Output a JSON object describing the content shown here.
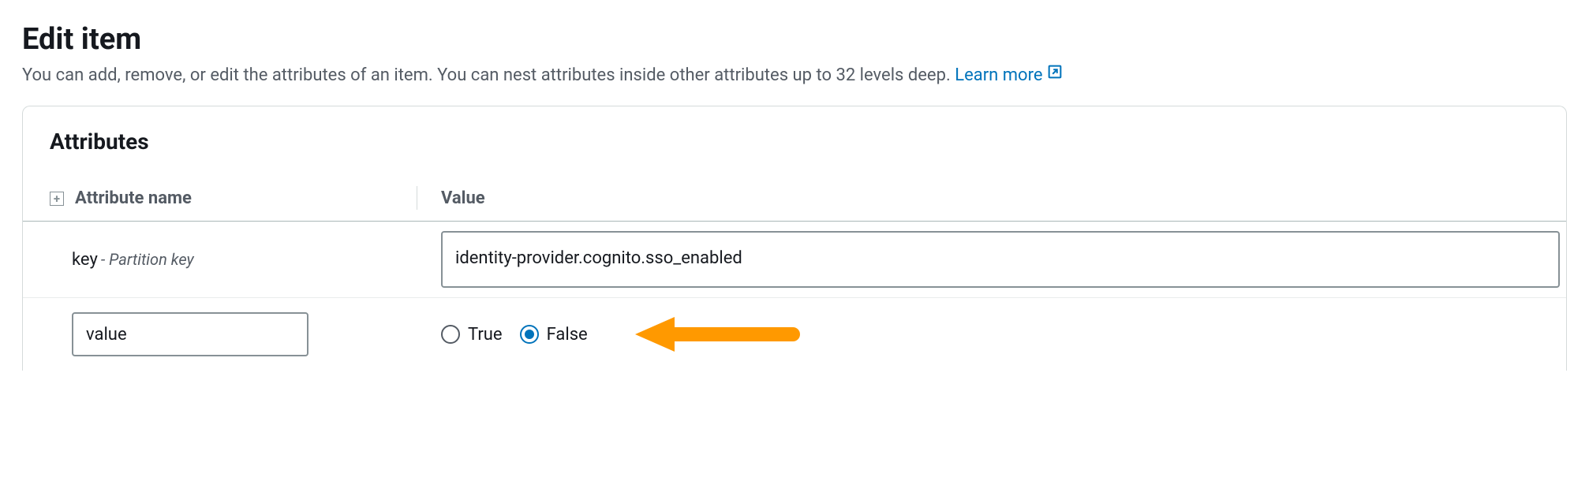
{
  "header": {
    "title": "Edit item",
    "description_prefix": "You can add, remove, or edit the attributes of an item. You can nest attributes inside other attributes up to 32 levels deep. ",
    "learn_more": "Learn more"
  },
  "panel": {
    "title": "Attributes",
    "columns": {
      "name": "Attribute name",
      "value": "Value"
    },
    "rows": [
      {
        "name": "key",
        "meta": " - Partition key",
        "value": "identity-provider.cognito.sso_enabled",
        "type": "text"
      },
      {
        "name": "value",
        "type": "boolean",
        "options": {
          "true": "True",
          "false": "False"
        },
        "selected": "false"
      }
    ]
  },
  "colors": {
    "link": "#0073bb",
    "annotation_arrow": "#ff9900"
  }
}
